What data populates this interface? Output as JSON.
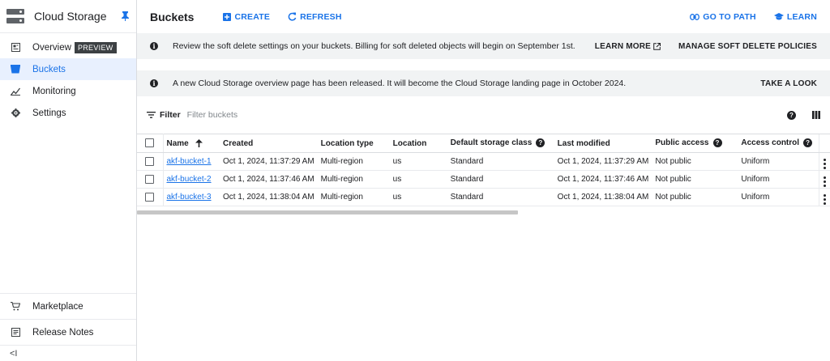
{
  "sidebar": {
    "title": "Cloud Storage",
    "items": [
      {
        "label": "Overview",
        "badge": "PREVIEW"
      },
      {
        "label": "Buckets"
      },
      {
        "label": "Monitoring"
      },
      {
        "label": "Settings"
      }
    ],
    "bottom_items": [
      {
        "label": "Marketplace"
      },
      {
        "label": "Release Notes"
      }
    ],
    "collapse_label": "<I"
  },
  "header": {
    "title": "Buckets",
    "create_label": "CREATE",
    "refresh_label": "REFRESH",
    "go_to_path_label": "GO TO PATH",
    "learn_label": "LEARN"
  },
  "banners": [
    {
      "message": "Review the soft delete settings on your buckets. Billing for soft deleted objects will begin on September 1st.",
      "actions": [
        "LEARN MORE",
        "MANAGE SOFT DELETE POLICIES"
      ]
    },
    {
      "message": "A new Cloud Storage overview page has been released. It will become the Cloud Storage landing page in October 2024.",
      "actions": [
        "TAKE A LOOK"
      ]
    }
  ],
  "filter": {
    "label": "Filter",
    "placeholder": "Filter buckets"
  },
  "table": {
    "columns": [
      "Name",
      "Created",
      "Location type",
      "Location",
      "Default storage class",
      "Last modified",
      "Public access",
      "Access control"
    ],
    "rows": [
      {
        "name": "akf-bucket-1",
        "created": "Oct 1, 2024, 11:37:29 AM",
        "location_type": "Multi-region",
        "location": "us",
        "storage_class": "Standard",
        "last_modified": "Oct 1, 2024, 11:37:29 AM",
        "public_access": "Not public",
        "access_control": "Uniform"
      },
      {
        "name": "akf-bucket-2",
        "created": "Oct 1, 2024, 11:37:46 AM",
        "location_type": "Multi-region",
        "location": "us",
        "storage_class": "Standard",
        "last_modified": "Oct 1, 2024, 11:37:46 AM",
        "public_access": "Not public",
        "access_control": "Uniform"
      },
      {
        "name": "akf-bucket-3",
        "created": "Oct 1, 2024, 11:38:04 AM",
        "location_type": "Multi-region",
        "location": "us",
        "storage_class": "Standard",
        "last_modified": "Oct 1, 2024, 11:38:04 AM",
        "public_access": "Not public",
        "access_control": "Uniform"
      }
    ]
  },
  "colors": {
    "accent": "#1a73e8",
    "active_bg": "#e8f0fe",
    "banner_bg": "#f1f3f4"
  }
}
